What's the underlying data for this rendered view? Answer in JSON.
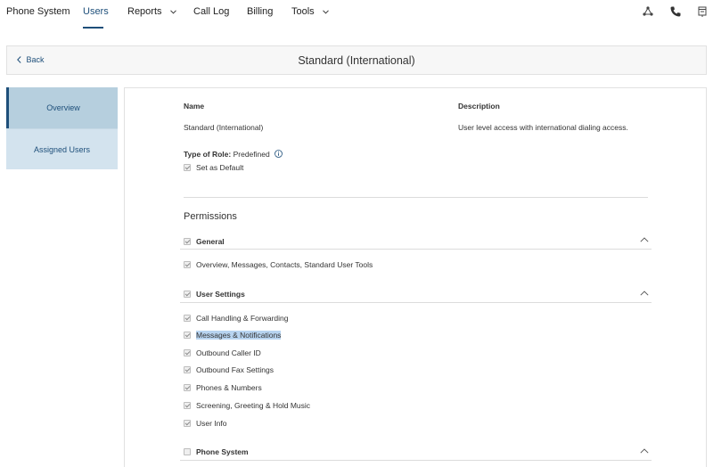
{
  "nav": {
    "items": [
      {
        "label": "Phone System"
      },
      {
        "label": "Users"
      },
      {
        "label": "Reports"
      },
      {
        "label": "Call Log"
      },
      {
        "label": "Billing"
      },
      {
        "label": "Tools"
      }
    ],
    "active": "Users"
  },
  "top_icons": [
    "network-icon",
    "phone-icon",
    "notifications-icon"
  ],
  "header": {
    "back_label": "Back",
    "title": "Standard (International)"
  },
  "sidebar": {
    "items": [
      {
        "label": "Overview",
        "active": true
      },
      {
        "label": "Assigned Users",
        "active": false
      }
    ]
  },
  "role": {
    "name_header": "Name",
    "description_header": "Description",
    "name": "Standard (International)",
    "description": "User level access with international dialing access.",
    "type_label": "Type of Role:",
    "type_value": "Predefined",
    "default_label": "Set as Default",
    "default_checked": true
  },
  "permissions": {
    "title": "Permissions",
    "sections": [
      {
        "name": "General",
        "checked": true,
        "items": [
          {
            "label": "Overview, Messages, Contacts, Standard User Tools",
            "checked": true
          }
        ]
      },
      {
        "name": "User Settings",
        "checked": true,
        "items": [
          {
            "label": "Call Handling & Forwarding",
            "checked": true
          },
          {
            "label": "Messages & Notifications",
            "checked": true,
            "selected": true
          },
          {
            "label": "Outbound Caller ID",
            "checked": true
          },
          {
            "label": "Outbound Fax Settings",
            "checked": true
          },
          {
            "label": "Phones & Numbers",
            "checked": true
          },
          {
            "label": "Screening, Greeting & Hold Music",
            "checked": true
          },
          {
            "label": "User Info",
            "checked": true
          }
        ]
      },
      {
        "name": "Phone System",
        "checked": false,
        "items": []
      }
    ]
  },
  "colors": {
    "accent": "#1e4f7a",
    "sidebar_bg": "#d3e3ee",
    "sidebar_active_bg": "#b6cfde",
    "selection_highlight": "#b8d4f0"
  }
}
